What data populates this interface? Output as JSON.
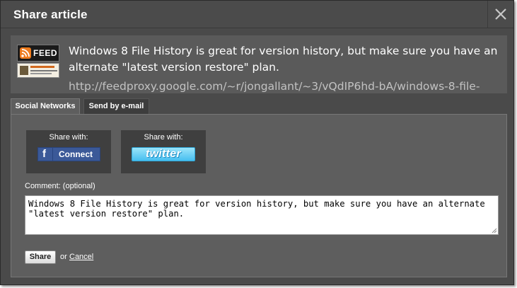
{
  "dialog": {
    "title": "Share article",
    "close_icon": "close-x-icon"
  },
  "article": {
    "feed_badge_label": "FEED",
    "feed_icon": "rss-icon",
    "title": "Windows 8 File History is great for version history, but make sure you have an alternate \"latest version restore\" plan.",
    "url": "http://feedproxy.google.com/~r/jongallant/~3/vQdIP6hd-bA/windows-8-file-"
  },
  "tabs": [
    {
      "label": "Social Networks",
      "active": true
    },
    {
      "label": "Send by e-mail",
      "active": false
    }
  ],
  "social": {
    "facebook": {
      "heading": "Share with:",
      "logo_letter": "f",
      "button_label": "Connect",
      "color": "#3b5998"
    },
    "twitter": {
      "heading": "Share with:",
      "button_label": "twitter",
      "color": "#47bff0"
    }
  },
  "comment": {
    "label": "Comment: (optional)",
    "value": "Windows 8 File History is great for version history, but make sure you have an alternate \"latest version restore\" plan."
  },
  "actions": {
    "share_label": "Share",
    "or_text": "or",
    "cancel_label": "Cancel"
  }
}
